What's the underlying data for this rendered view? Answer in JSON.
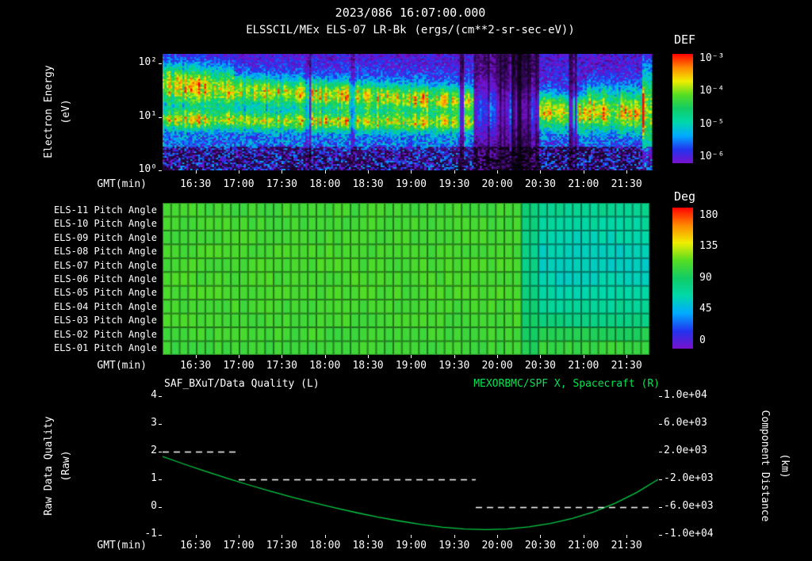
{
  "header": {
    "datetime": "2023/086 16:07:00.000",
    "title": "ELSSCIL/MEx ELS-07 LR-Bk",
    "units": "(ergs/(cm**2-sr-sec-eV))"
  },
  "colormap": {
    "colors": [
      "#ff0000",
      "#ff8800",
      "#f0ee00",
      "#55dd22",
      "#11cc66",
      "#00d8aa",
      "#00aaff",
      "#2233ee",
      "#7711cc"
    ],
    "floor": 0.15
  },
  "time_axis": {
    "label": "GMT(min)",
    "start": "16:07",
    "end": "21:52",
    "range_minutes": [
      0,
      345
    ],
    "ticks": [
      {
        "t": 23,
        "label": "16:30"
      },
      {
        "t": 53,
        "label": "17:00"
      },
      {
        "t": 83,
        "label": "17:30"
      },
      {
        "t": 113,
        "label": "18:00"
      },
      {
        "t": 143,
        "label": "18:30"
      },
      {
        "t": 173,
        "label": "19:00"
      },
      {
        "t": 203,
        "label": "19:30"
      },
      {
        "t": 233,
        "label": "20:00"
      },
      {
        "t": 263,
        "label": "20:30"
      },
      {
        "t": 293,
        "label": "21:00"
      },
      {
        "t": 323,
        "label": "21:30"
      }
    ]
  },
  "top_panel": {
    "ylabel": "Electron Energy",
    "ylabel_units": "(eV)",
    "colorbar_label": "DEF",
    "colorbar_ticks": [
      "10⁻³",
      "10⁻⁴",
      "10⁻⁵",
      "10⁻⁶"
    ],
    "energy_ticks": [
      {
        "logE": 2,
        "label": "10²"
      },
      {
        "logE": 1,
        "label": "10¹"
      },
      {
        "logE": 0,
        "label": "10⁰"
      }
    ]
  },
  "pitch_panel": {
    "colorbar_label": "Deg",
    "colorbar_ticks": [
      "180",
      "135",
      "90",
      "45",
      "0"
    ]
  },
  "bottom_panel": {
    "title_left": "SAF_BXuT/Data Quality (L)",
    "title_right": "MEXORBMC/SPF X, Spacecraft (R)",
    "title_right_color": "#00e550",
    "ylabel_left": "Raw Data Quality",
    "ylabel_left_units": "(Raw)",
    "ylabel_right": "Component Distance",
    "ylabel_right_units": "(km)",
    "left_ticks": [
      "4",
      "3",
      "2",
      "1",
      "0",
      "-1"
    ],
    "right_ticks": [
      "1.0e+04",
      "6.0e+03",
      "2.0e+03",
      "-2.0e+03",
      "-6.0e+03",
      "-1.0e+04"
    ]
  },
  "chart_data": [
    {
      "name": "electron_energy_spectrogram",
      "type": "heatmap",
      "x_axis": "GMT minutes from 16:07",
      "x_range": [
        0,
        345
      ],
      "y_axis": "Electron Energy (eV), log scale",
      "y_range_eV": [
        1,
        151
      ],
      "log_e_max": 2.18,
      "z_axis": "DEF (ergs/(cm**2-sr-sec-eV))",
      "z_range": [
        1e-06,
        0.001
      ],
      "seed": 11,
      "base": 0.3,
      "base_slope": 0.055,
      "end_t": 341,
      "bands": [
        {
          "t0": 0,
          "t1": 50,
          "e0": 1.66,
          "e1": 1.54,
          "w": 0.24,
          "amp": 0.5
        },
        {
          "t0": 50,
          "t1": 216,
          "e0": 1.52,
          "e1": 1.3,
          "w": 0.17,
          "amp": 0.44
        },
        {
          "t0": 0,
          "t1": 216,
          "e0": 0.94,
          "e1": 0.88,
          "w": 0.11,
          "amp": 0.4
        },
        {
          "t0": 0,
          "t1": 216,
          "e0": 1.25,
          "e1": 1.1,
          "w": 0.42,
          "amp": 0.16
        },
        {
          "t0": 216,
          "t1": 260,
          "e0": 1.15,
          "e1": 1.1,
          "w": 0.3,
          "amp": 0.3
        },
        {
          "t0": 260,
          "t1": 336,
          "e0": 1.12,
          "e1": 1.02,
          "w": 0.22,
          "amp": 0.55
        },
        {
          "t0": 295,
          "t1": 336,
          "e0": 1.45,
          "e1": 1.38,
          "w": 0.18,
          "amp": 0.17
        },
        {
          "t0": 334,
          "t1": 341,
          "e0": 1.15,
          "e1": 1.15,
          "w": 0.5,
          "amp": 0.45
        }
      ],
      "gaps": [
        {
          "t0": 216,
          "t1": 262,
          "f": 0.4
        },
        {
          "t0": 243,
          "t1": 252,
          "f": 0.3
        },
        {
          "t0": 100,
          "t1": 103,
          "f": 0.55
        },
        {
          "t0": 131,
          "t1": 134,
          "f": 0.6
        },
        {
          "t0": 206,
          "t1": 210,
          "f": 0.55
        },
        {
          "t0": 283,
          "t1": 288,
          "f": 0.45
        }
      ]
    },
    {
      "name": "pitch_angles",
      "type": "heatmap",
      "z_axis": "Pitch Angle (Deg)",
      "z_range": [
        0,
        180
      ],
      "cols": 58,
      "seed": 5,
      "noise": 3,
      "t_mid": [
        249,
        264
      ],
      "end_t": 338,
      "rows": [
        {
          "label": "ELS-11 Pitch Angle",
          "before": 106,
          "mid": 84,
          "after": 76
        },
        {
          "label": "ELS-10 Pitch Angle",
          "before": 107,
          "mid": 82,
          "after": 71
        },
        {
          "label": "ELS-09 Pitch Angle",
          "before": 107,
          "mid": 80,
          "after": 66
        },
        {
          "label": "ELS-08 Pitch Angle",
          "before": 108,
          "mid": 79,
          "after": 63
        },
        {
          "label": "ELS-07 Pitch Angle",
          "before": 108,
          "mid": 79,
          "after": 62
        },
        {
          "label": "ELS-06 Pitch Angle",
          "before": 108,
          "mid": 80,
          "after": 64
        },
        {
          "label": "ELS-05 Pitch Angle",
          "before": 108,
          "mid": 82,
          "after": 68
        },
        {
          "label": "ELS-04 Pitch Angle",
          "before": 107,
          "mid": 85,
          "after": 74
        },
        {
          "label": "ELS-03 Pitch Angle",
          "before": 107,
          "mid": 88,
          "after": 82
        },
        {
          "label": "ELS-02 Pitch Angle",
          "before": 106,
          "mid": 92,
          "after": 95
        },
        {
          "label": "ELS-01 Pitch Angle",
          "before": 105,
          "mid": 96,
          "after": 103
        }
      ]
    },
    {
      "name": "quality_and_position",
      "type": "line",
      "left_axis": {
        "label": "Raw Data Quality (Raw)",
        "range": [
          -1,
          4
        ]
      },
      "right_axis": {
        "label": "Component Distance (km)",
        "range": [
          -10000,
          10000
        ]
      },
      "series": [
        {
          "name": "SAF_BXuT/Data Quality (L)",
          "axis": "left",
          "style": "dashed",
          "color": "#ffffff",
          "segments": [
            {
              "t0": 0,
              "t1": 53,
              "value": 2
            },
            {
              "t0": 53,
              "t1": 218,
              "value": 1
            },
            {
              "t0": 218,
              "t1": 339,
              "value": 0
            }
          ]
        },
        {
          "name": "MEXORBMC/SPF X, Spacecraft (R)",
          "axis": "right",
          "style": "solid",
          "color": "#00cc44",
          "t": [
            0,
            15,
            30,
            45,
            60,
            75,
            90,
            105,
            120,
            135,
            150,
            165,
            180,
            195,
            210,
            225,
            240,
            255,
            270,
            285,
            300,
            315,
            330,
            345
          ],
          "km": [
            1300,
            200,
            -850,
            -1850,
            -2800,
            -3700,
            -4550,
            -5350,
            -6100,
            -6800,
            -7450,
            -8000,
            -8500,
            -8900,
            -9150,
            -9250,
            -9150,
            -8850,
            -8350,
            -7650,
            -6700,
            -5450,
            -3900,
            -2000
          ]
        }
      ]
    }
  ]
}
